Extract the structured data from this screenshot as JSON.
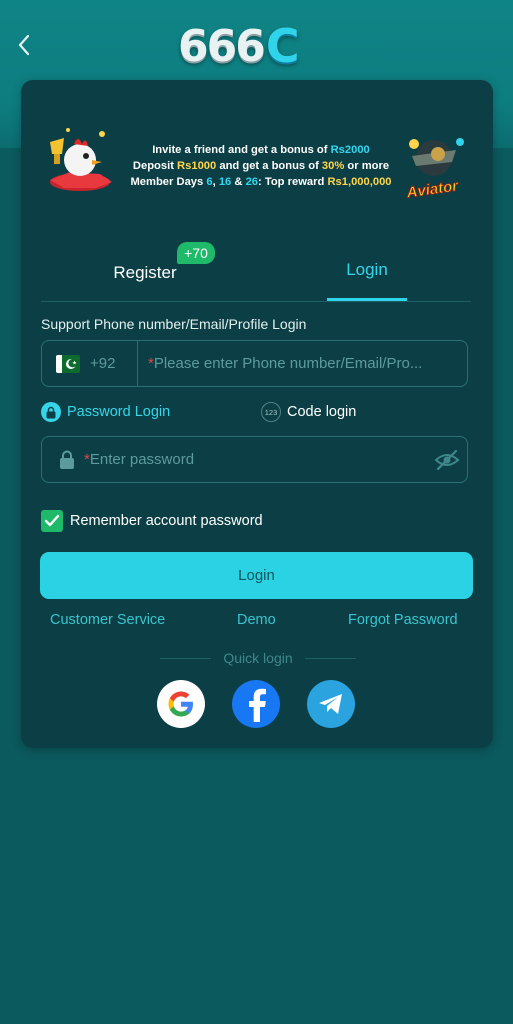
{
  "header": {
    "back_icon": "chevron-left-icon",
    "logo_digits": "666",
    "logo_letter": "C"
  },
  "banner": {
    "line1_prefix": "Invite a friend and get a bonus of ",
    "line1_amount": "Rs2000",
    "line2_prefix": "Deposit ",
    "line2_amount": "Rs1000",
    "line2_mid": " and get a bonus of ",
    "line2_percent": "30%",
    "line2_suffix": " or more",
    "line3_prefix": "Member Days ",
    "line3_day1": "6",
    "line3_sep1": ", ",
    "line3_day2": "16",
    "line3_sep2": " & ",
    "line3_day3": "26",
    "line3_mid": ": Top reward ",
    "line3_amount": "Rs1,000,000",
    "game_label": "Aviator"
  },
  "tabs": {
    "register_label": "Register",
    "register_badge": "+70",
    "login_label": "Login",
    "active": "login"
  },
  "form": {
    "account_label": "Support Phone number/Email/Profile Login",
    "country_code": "+92",
    "account_placeholder": "Please enter Phone number/Email/Pro...",
    "required_mark": "*",
    "method_password_label": "Password Login",
    "method_code_label": "Code login",
    "method_code_icon_text": "123",
    "password_placeholder": "Enter password",
    "remember_label": "Remember account password",
    "remember_checked": true,
    "login_button": "Login"
  },
  "links": {
    "customer_service": "Customer Service",
    "demo": "Demo",
    "forgot_password": "Forgot Password"
  },
  "quick_login": {
    "label": "Quick login",
    "providers": [
      "google-icon",
      "facebook-icon",
      "telegram-icon"
    ]
  },
  "colors": {
    "accent": "#2bd2e3",
    "background": "#0b5a5e",
    "card": "#0c3f45",
    "highlight": "#ffd54a",
    "badge": "#1fb96a"
  }
}
